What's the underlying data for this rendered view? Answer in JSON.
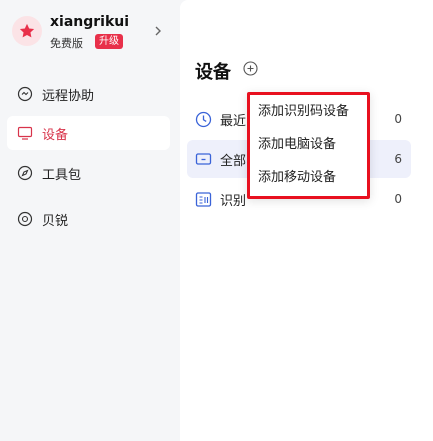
{
  "profile": {
    "username": "xiangrikui",
    "plan": "免费版",
    "upgrade_label": "升级"
  },
  "sidebar": {
    "items": [
      {
        "label": "远程协助",
        "icon": "remote-assist-icon"
      },
      {
        "label": "设备",
        "icon": "monitor-icon",
        "active": true
      },
      {
        "label": "工具包",
        "icon": "compass-icon"
      },
      {
        "label": "贝锐",
        "icon": "circle-logo-icon"
      }
    ]
  },
  "main": {
    "title": "设备",
    "rows": [
      {
        "label": "最近",
        "count": "0",
        "icon": "clock-icon"
      },
      {
        "label": "全部",
        "count": "6",
        "icon": "monitor-icon",
        "selected": true
      },
      {
        "label": "识别",
        "count": "0",
        "icon": "id-code-icon"
      }
    ]
  },
  "dropdown": {
    "items": [
      "添加识别码设备",
      "添加电脑设备",
      "添加移动设备"
    ]
  },
  "colors": {
    "accent": "#d8334a",
    "upgrade_badge": "#e8304a",
    "highlight_border": "#e8101f",
    "selected_row": "#eef0fb",
    "icon_blue": "#3a63d8"
  }
}
